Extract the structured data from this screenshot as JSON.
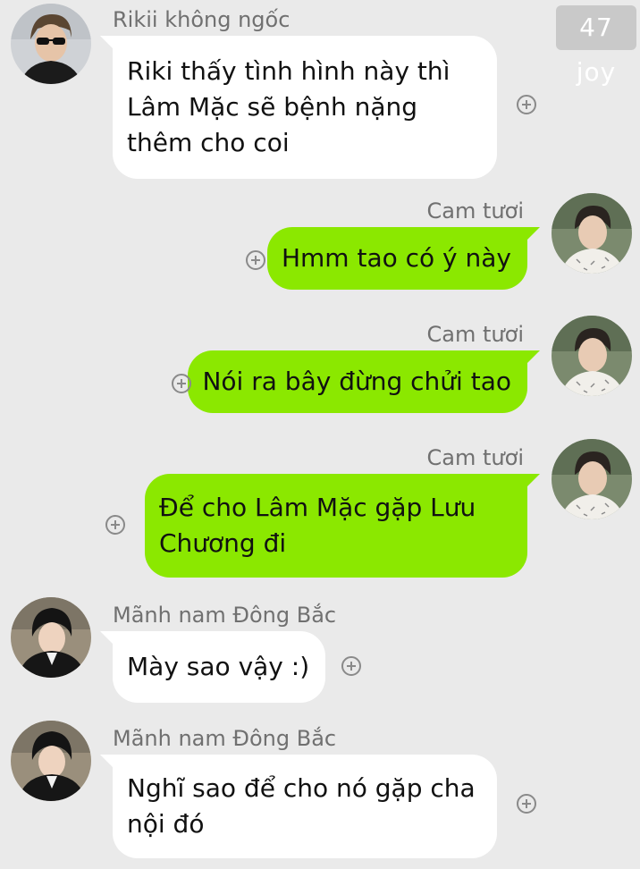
{
  "watermark": "47 joy",
  "messages": [
    {
      "sender": "Rikii không ngốc",
      "side": "left",
      "text": "Riki thấy tình hình này thì Lâm Mặc sẽ bệnh nặng thêm cho coi",
      "avatar_icon": "user-avatar-riki"
    },
    {
      "sender": "Cam tươi",
      "side": "right",
      "text": "Hmm tao có ý này",
      "avatar_icon": "user-avatar-cam-tuoi"
    },
    {
      "sender": "Cam tươi",
      "side": "right",
      "text": "Nói ra bây đừng chửi tao",
      "avatar_icon": "user-avatar-cam-tuoi"
    },
    {
      "sender": "Cam tươi",
      "side": "right",
      "text": "Để cho Lâm Mặc gặp Lưu Chương đi",
      "avatar_icon": "user-avatar-cam-tuoi"
    },
    {
      "sender": "Mãnh nam Đông Bắc",
      "side": "left",
      "text": "Mày sao vậy :)",
      "avatar_icon": "user-avatar-manh-nam"
    },
    {
      "sender": "Mãnh nam Đông Bắc",
      "side": "left",
      "text": "Nghĩ sao để cho nó gặp cha nội đó",
      "avatar_icon": "user-avatar-manh-nam"
    }
  ],
  "colors": {
    "background": "#eaeaea",
    "left_bubble": "#ffffff",
    "right_bubble": "#8be800",
    "name_text": "#707070"
  },
  "icons": {
    "react": "add-reaction-icon"
  }
}
